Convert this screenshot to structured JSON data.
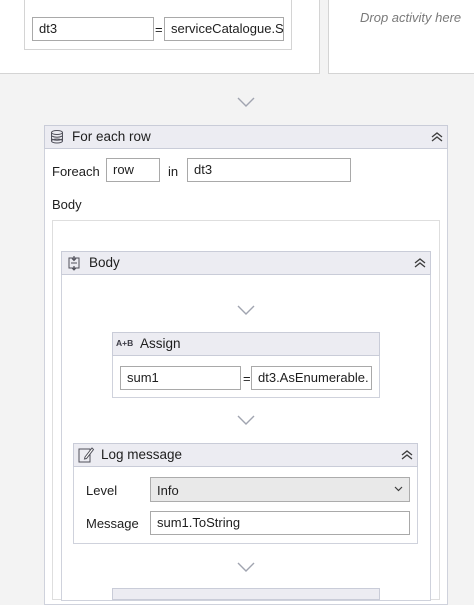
{
  "top_assign": {
    "left_value": "dt3",
    "equals": "=",
    "right_value": "serviceCatalogue.S"
  },
  "drop_hint": "Drop activity here",
  "foreach": {
    "title": "For each row",
    "foreach_label": "Foreach",
    "item_value": "row",
    "in_label": "in",
    "collection_value": "dt3",
    "body_label": "Body"
  },
  "body_sequence": {
    "title": "Body"
  },
  "assign": {
    "badge": "A+B",
    "title": "Assign",
    "left_value": "sum1",
    "equals": "=",
    "right_value": "dt3.AsEnumerable."
  },
  "log_message": {
    "title": "Log message",
    "level_label": "Level",
    "level_value": "Info",
    "message_label": "Message",
    "message_value": "sum1.ToString"
  }
}
